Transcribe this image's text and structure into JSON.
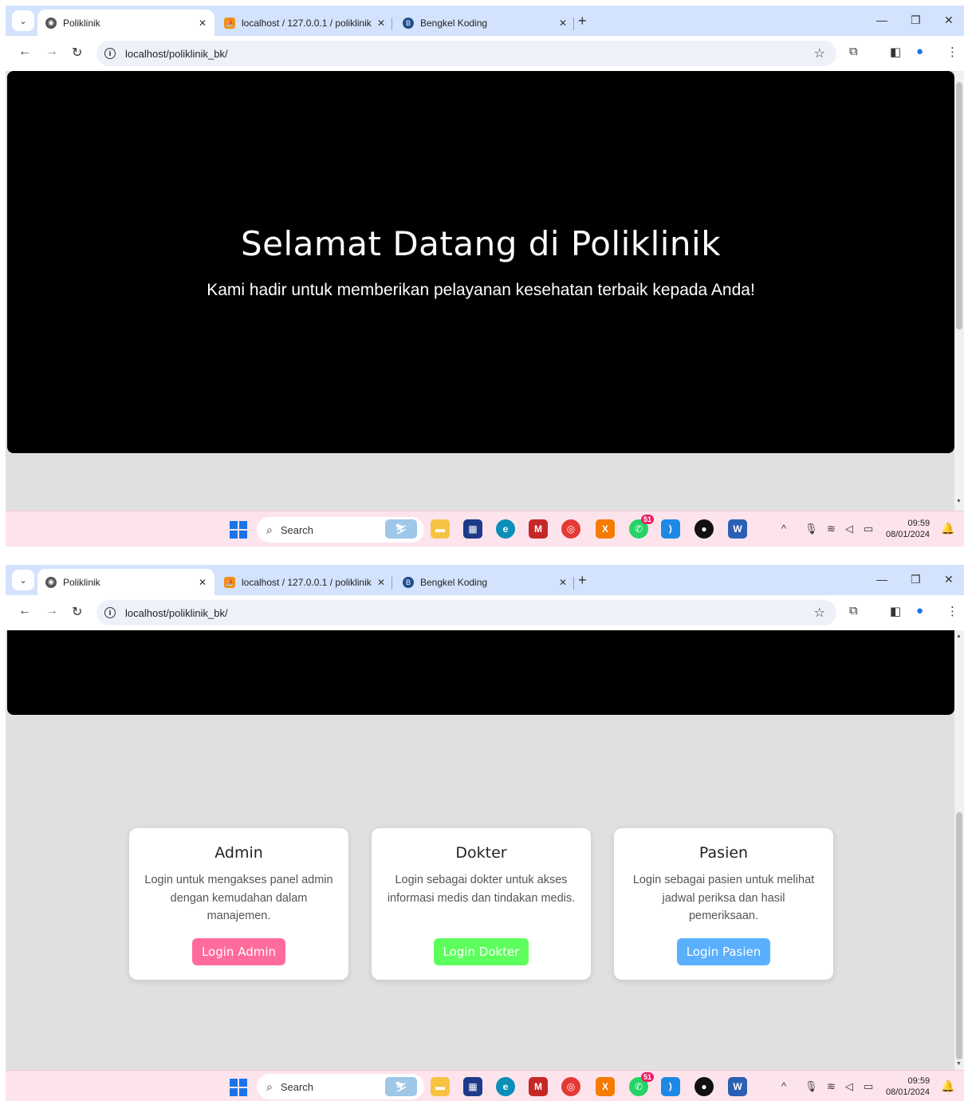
{
  "browser": {
    "tabs": [
      {
        "title": "Poliklinik",
        "active": true
      },
      {
        "title": "localhost / 127.0.0.1 / poliklinik",
        "active": false
      },
      {
        "title": "Bengkel Koding",
        "active": false
      }
    ],
    "url": "localhost/poliklinik_bk/"
  },
  "hero": {
    "title": "Selamat Datang di Poliklinik",
    "subtitle": "Kami hadir untuk memberikan pelayanan kesehatan terbaik kepada Anda!"
  },
  "cards": [
    {
      "title": "Admin",
      "description": "Login untuk mengakses panel admin dengan kemudahan dalam manajemen.",
      "button": "Login Admin",
      "color": "#ff6b9a"
    },
    {
      "title": "Dokter",
      "description": "Login sebagai dokter untuk akses informasi medis dan tindakan medis.",
      "button": "Login Dokter",
      "color": "#5cff5c"
    },
    {
      "title": "Pasien",
      "description": "Login sebagai pasien untuk melihat jadwal periksa dan hasil pemeriksaan.",
      "button": "Login Pasien",
      "color": "#5ab0ff"
    }
  ],
  "taskbar": {
    "search": "Search",
    "time": "09:59",
    "date": "08/01/2024",
    "whatsapp_badge": "51"
  }
}
